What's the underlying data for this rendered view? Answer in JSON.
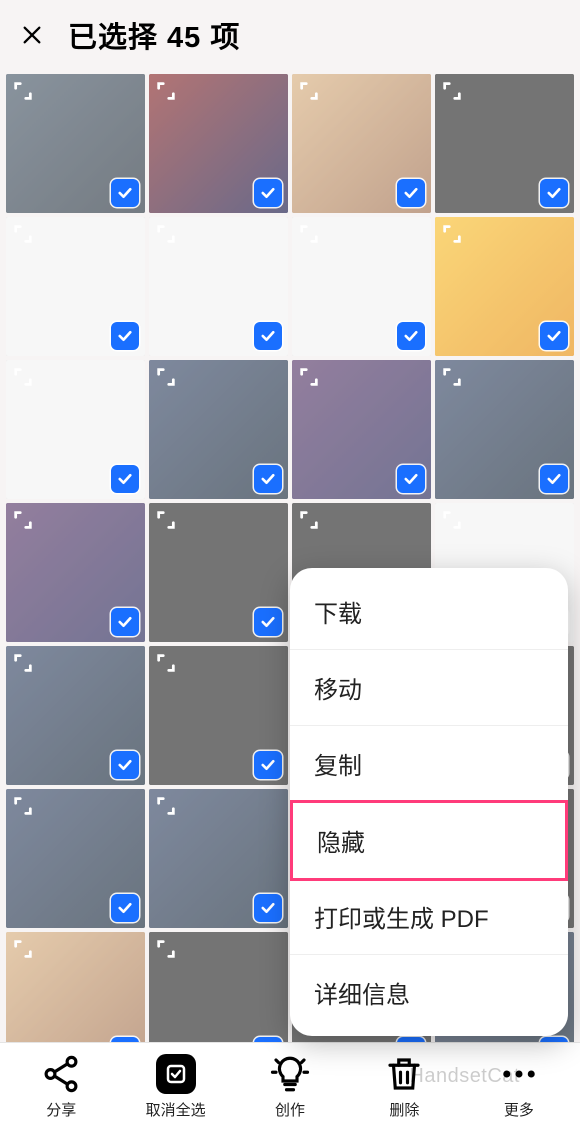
{
  "header": {
    "title": "已选择 45 项"
  },
  "popup": {
    "items": [
      {
        "label": "下载",
        "highlight": false
      },
      {
        "label": "移动",
        "highlight": false
      },
      {
        "label": "复制",
        "highlight": false
      },
      {
        "label": "隐藏",
        "highlight": true
      },
      {
        "label": "打印或生成 PDF",
        "highlight": false
      },
      {
        "label": "详细信息",
        "highlight": false
      }
    ]
  },
  "bottom": {
    "items": [
      {
        "label": "分享",
        "icon": "share-icon"
      },
      {
        "label": "取消全选",
        "icon": "deselect-icon",
        "active": true
      },
      {
        "label": "创作",
        "icon": "lightbulb-icon"
      },
      {
        "label": "删除",
        "icon": "trash-icon"
      },
      {
        "label": "更多",
        "icon": "more-icon"
      }
    ]
  },
  "grid": {
    "count": 28,
    "variants": [
      "a",
      "b",
      "c",
      "d",
      "e",
      "e",
      "e",
      "f",
      "e",
      "g",
      "h",
      "g",
      "h",
      "d",
      "d",
      "e",
      "g",
      "d",
      "h",
      "d",
      "g",
      "g",
      "d",
      "d",
      "c",
      "d",
      "d",
      "g"
    ]
  },
  "watermark": "HandsetCat"
}
